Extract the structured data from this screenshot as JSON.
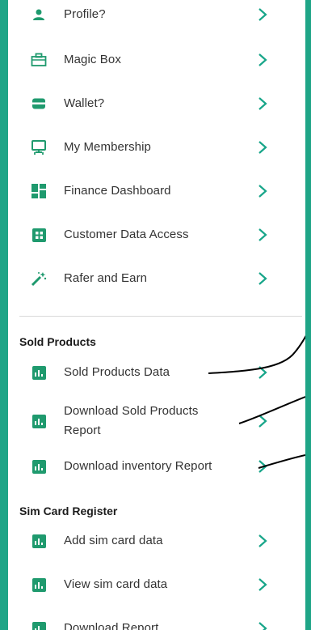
{
  "menu": {
    "items": [
      {
        "label": "Profile?",
        "icon": "person-icon"
      },
      {
        "label": "Magic Box",
        "icon": "briefcase-icon"
      },
      {
        "label": "Wallet?",
        "icon": "wallet-icon"
      },
      {
        "label": "My Membership",
        "icon": "membership-icon"
      },
      {
        "label": "Finance Dashboard",
        "icon": "dashboard-icon"
      },
      {
        "label": "Customer Data Access",
        "icon": "grid-icon"
      },
      {
        "label": "Rafer and Earn",
        "icon": "magic-wand-icon"
      }
    ]
  },
  "sold_products": {
    "title": "Sold Products",
    "items": [
      {
        "label": "Sold Products Data",
        "icon": "bar-chart-icon"
      },
      {
        "label": "Download Sold Products Report",
        "icon": "bar-chart-icon"
      },
      {
        "label": "Download inventory Report",
        "icon": "bar-chart-icon"
      }
    ]
  },
  "sim_card": {
    "title": "Sim Card Register",
    "items": [
      {
        "label": "Add sim card data",
        "icon": "bar-chart-icon"
      },
      {
        "label": "View sim card data",
        "icon": "bar-chart-icon"
      },
      {
        "label": "Download Report",
        "icon": "bar-chart-icon"
      }
    ]
  },
  "colors": {
    "frame": "#1fa587",
    "icon_green": "#1f9a6e",
    "chevron": "#17a589"
  }
}
